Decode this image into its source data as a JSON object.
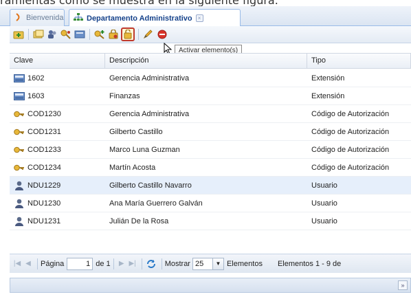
{
  "caption": "ramientas como se muestra en la siguiente figura.",
  "tabs": [
    {
      "label": "Bienvenida",
      "icon": "welcome-icon"
    },
    {
      "label": "Departamento Administrativo",
      "icon": "org-chart-icon"
    }
  ],
  "toolbar": {
    "buttons": [
      "add-icon",
      "group-icon",
      "users-icon",
      "key-users-icon",
      "extension-icon",
      "key-add-icon",
      "key-lock-icon",
      "activate-icon",
      "edit-icon",
      "delete-icon"
    ]
  },
  "tooltip": "Activar elemento(s)",
  "columns": {
    "clave": "Clave",
    "descripcion": "Descripción",
    "tipo": "Tipo"
  },
  "rows": [
    {
      "clave": "1602",
      "descripcion": "Gerencia Administrativa",
      "tipo": "Extensión",
      "icon": "phone-icon"
    },
    {
      "clave": "1603",
      "descripcion": "Finanzas",
      "tipo": "Extensión",
      "icon": "phone-icon"
    },
    {
      "clave": "COD1230",
      "descripcion": "Gerencia Administrativa",
      "tipo": "Código de Autorización",
      "icon": "key-icon"
    },
    {
      "clave": "COD1231",
      "descripcion": "Gilberto Castillo",
      "tipo": "Código de Autorización",
      "icon": "key-icon"
    },
    {
      "clave": "COD1233",
      "descripcion": "Marco Luna Guzman",
      "tipo": "Código de Autorización",
      "icon": "key-icon"
    },
    {
      "clave": "COD1234",
      "descripcion": "Martín Acosta",
      "tipo": "Código de Autorización",
      "icon": "key-icon"
    },
    {
      "clave": "NDU1229",
      "descripcion": "Gilberto Castillo Navarro",
      "tipo": "Usuario",
      "icon": "user-icon"
    },
    {
      "clave": "NDU1230",
      "descripcion": "Ana María Guerrero Galván",
      "tipo": "Usuario",
      "icon": "user-icon"
    },
    {
      "clave": "NDU1231",
      "descripcion": "Julián De la Rosa",
      "tipo": "Usuario",
      "icon": "user-icon"
    }
  ],
  "selected_row": 6,
  "paging": {
    "page_label": "Página",
    "page_value": "1",
    "of_label": "de 1",
    "show_label": "Mostrar",
    "page_size": "25",
    "elements_label": "Elementos",
    "summary": "Elementos 1 - 9 de"
  },
  "colors": {
    "accent": "#15428b",
    "selected_row": "#e6effb",
    "highlight_border": "#c0392b"
  }
}
